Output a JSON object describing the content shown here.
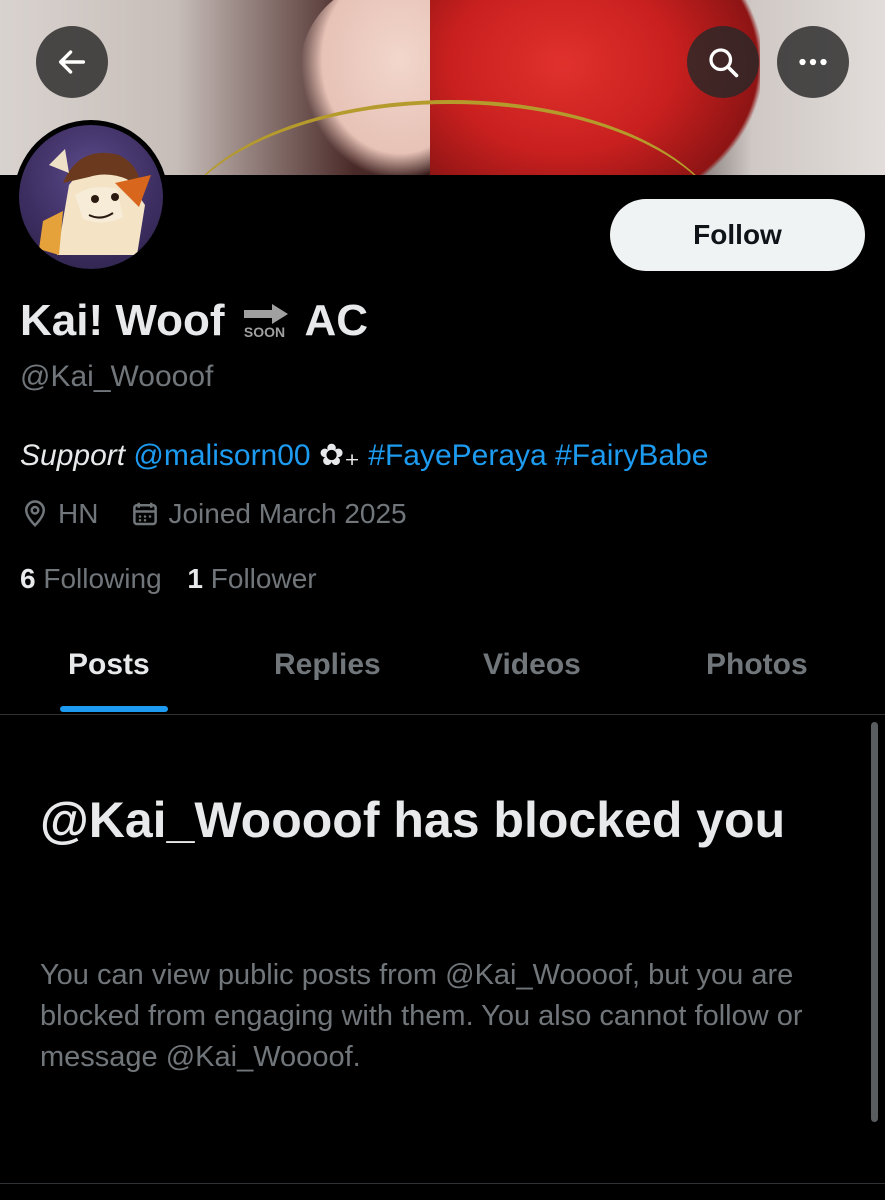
{
  "header": {
    "back_icon": "arrow-left-icon",
    "search_icon": "search-icon",
    "more_icon": "more-horizontal-icon"
  },
  "profile": {
    "name_part1": "Kai! Woof",
    "name_emoji_text": "SOON",
    "name_part2": "AC",
    "handle": "@Kai_Woooof",
    "follow_label": "Follow",
    "bio": {
      "prefix": "Support",
      "mention": "@malisorn00",
      "flower": "✿₊",
      "tag1": "#FayePeraya",
      "tag2": "#FairyBabe"
    },
    "location": "HN",
    "joined": "Joined March 2025",
    "following_count": "6",
    "following_label": "Following",
    "followers_count": "1",
    "followers_label": "Follower"
  },
  "tabs": [
    {
      "label": "Posts",
      "active": true
    },
    {
      "label": "Replies",
      "active": false
    },
    {
      "label": "Videos",
      "active": false
    },
    {
      "label": "Photos",
      "active": false
    }
  ],
  "blocked": {
    "title": "@Kai_Woooof has blocked you",
    "body": "You can view public posts from @Kai_Woooof, but you are blocked from engaging with them. You also cannot follow or message @Kai_Woooof."
  },
  "colors": {
    "accent": "#1d9bf0",
    "background": "#000000",
    "secondary_text": "#71767b"
  }
}
